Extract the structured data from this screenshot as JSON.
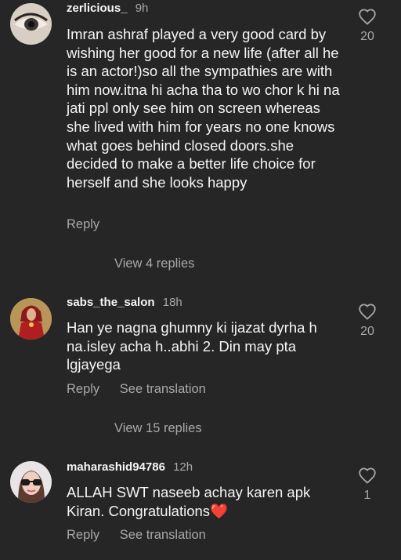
{
  "comments": [
    {
      "username": "zerlicious_",
      "time": "9h",
      "text": "Imran ashraf played a very good card by wishing her good for a new life (after all he is an actor!)so all the sympathies are with him now.itna hi acha tha to wo chor k hi na jati ppl only see him on screen whereas she lived with him for years no one knows what goes behind closed doors.she decided to make a better life choice for herself and she looks happy",
      "likes": "20",
      "reply_label": "Reply",
      "view_replies": "View 4 replies"
    },
    {
      "username": "sabs_the_salon",
      "time": "18h",
      "text": "Han ye nagna ghumny ki ijazat dyrha h na.isley acha h..abhi 2. Din may pta lgjayega",
      "likes": "20",
      "reply_label": "Reply",
      "translate_label": "See translation",
      "view_replies": "View 15 replies"
    },
    {
      "username": "maharashid94786",
      "time": "12h",
      "text": "ALLAH SWT naseeb achay karen apk Kiran. Congratulations",
      "emoji": "❤️",
      "likes": "1",
      "reply_label": "Reply",
      "translate_label": "See translation"
    }
  ],
  "colors": {
    "background": "#262626",
    "text": "#f5f5f5",
    "secondary": "#a8a8a8",
    "heart": "#e0245e"
  }
}
